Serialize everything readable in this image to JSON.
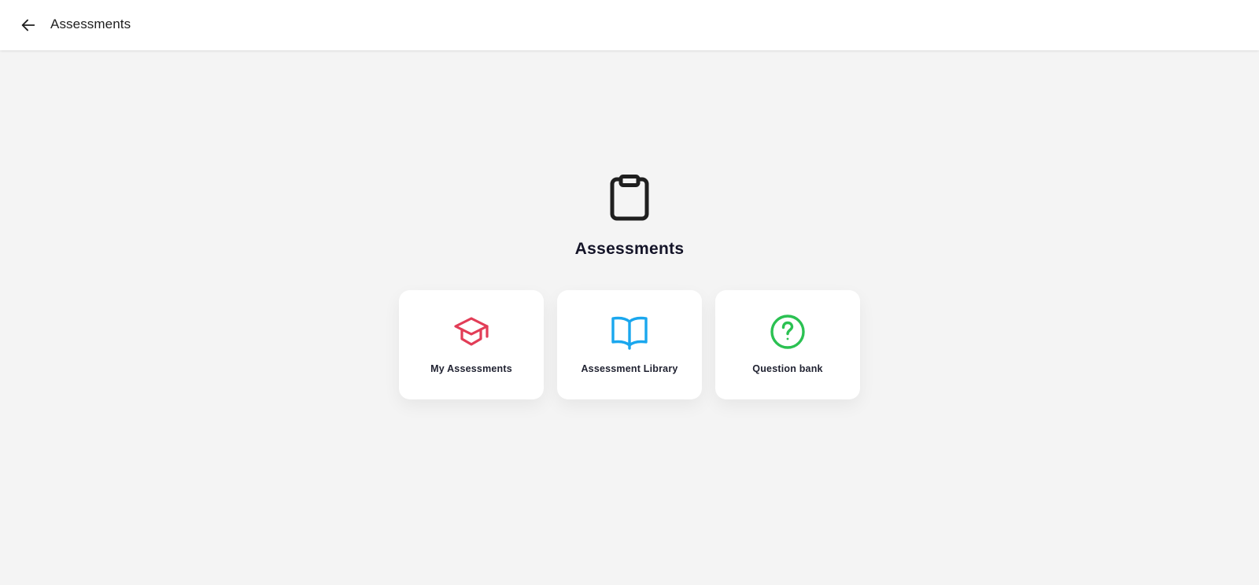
{
  "header": {
    "title": "Assessments",
    "back_icon": "arrow-left-icon"
  },
  "hero": {
    "icon": "clipboard-icon",
    "title": "Assessments"
  },
  "cards": [
    {
      "label": "My Assessments",
      "icon": "graduation-cap-icon",
      "color": "#e23d57"
    },
    {
      "label": "Assessment Library",
      "icon": "open-book-icon",
      "color": "#1aa7ee"
    },
    {
      "label": "Question bank",
      "icon": "question-circle-icon",
      "color": "#2bc152"
    }
  ],
  "colors": {
    "background": "#f4f4f4",
    "surface": "#ffffff",
    "text": "#1f1f1f"
  }
}
